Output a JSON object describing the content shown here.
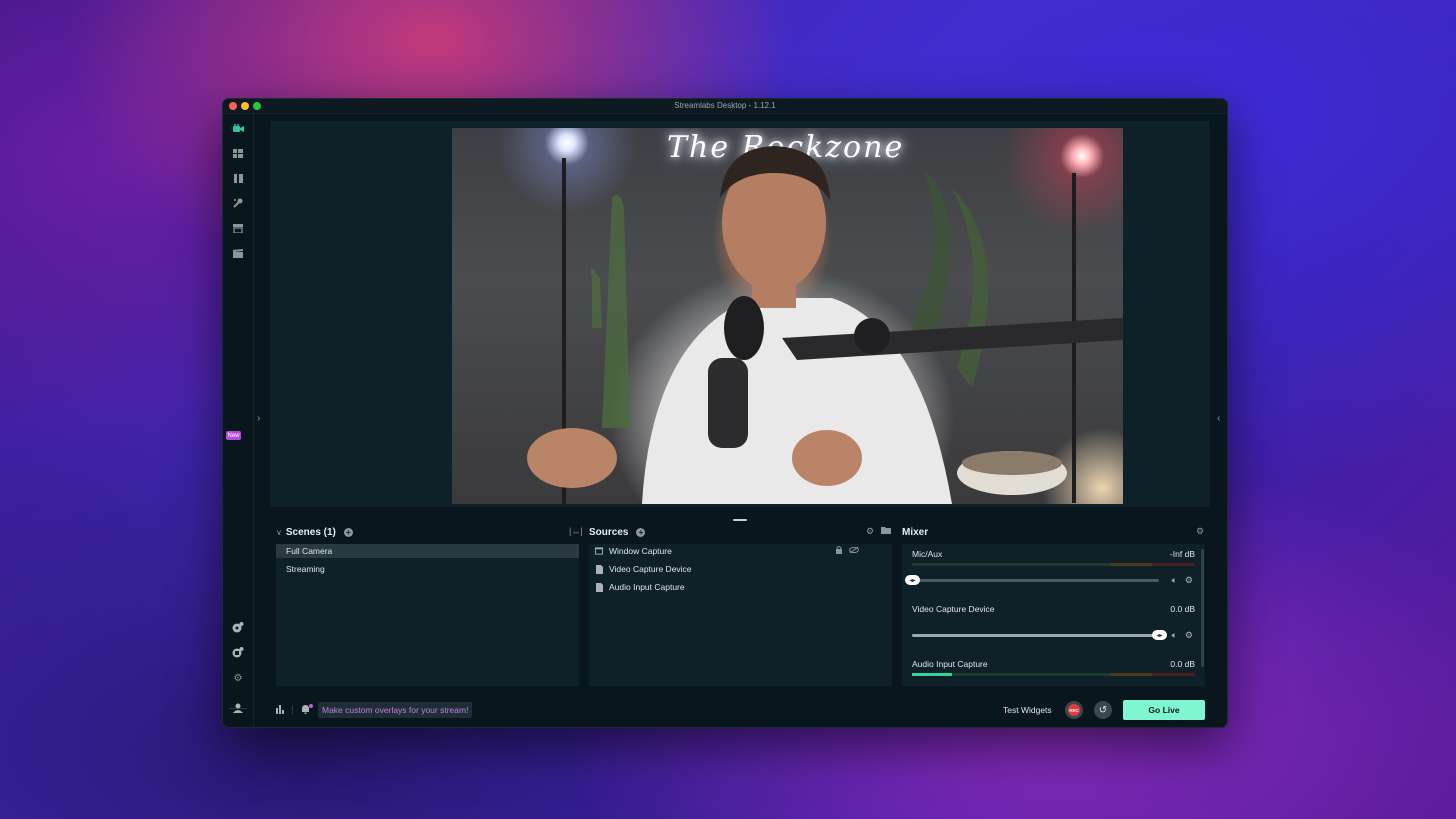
{
  "window": {
    "title": "Streamlabs Desktop - 1.12.1"
  },
  "sidebar": {
    "items": [
      {
        "name": "editor-icon",
        "active": true
      },
      {
        "name": "layout-icon"
      },
      {
        "name": "theme-icon"
      },
      {
        "name": "app-store-icon"
      },
      {
        "name": "store-icon"
      },
      {
        "name": "highlighter-icon"
      }
    ],
    "new_badge": "New",
    "bottom_items": [
      "dashboard-icon",
      "cloudbot-icon",
      "settings-icon",
      "profile-icon"
    ]
  },
  "preview": {
    "neon_sign": "The Rockzone"
  },
  "scenes": {
    "title": "Scenes (1)",
    "items": [
      {
        "label": "Full Camera",
        "selected": true
      },
      {
        "label": "Streaming",
        "selected": false
      }
    ]
  },
  "sources": {
    "title": "Sources",
    "items": [
      {
        "label": "Window Capture",
        "icon": "window-icon"
      },
      {
        "label": "Video Capture Device",
        "icon": "file-icon"
      },
      {
        "label": "Audio Input Capture",
        "icon": "file-icon"
      }
    ]
  },
  "mixer": {
    "title": "Mixer",
    "items": [
      {
        "name": "Mic/Aux",
        "db": "-Inf dB",
        "level": 0.0,
        "volume": 0.0
      },
      {
        "name": "Video Capture Device",
        "db": "0.0 dB",
        "level": 0.0,
        "volume": 1.0
      },
      {
        "name": "Audio Input Capture",
        "db": "0.0 dB",
        "level": 0.14,
        "volume": 1.0
      }
    ]
  },
  "footer": {
    "promo": "Make custom overlays for your stream!",
    "test_widgets": "Test Widgets",
    "rec": "REC",
    "go_live": "Go Live"
  },
  "colors": {
    "accent": "#31c3a2",
    "go_live_bg": "#80f5d2",
    "rec": "#e03d3d",
    "promo_text": "#c27ee6",
    "new_badge": "#b44bd9"
  }
}
